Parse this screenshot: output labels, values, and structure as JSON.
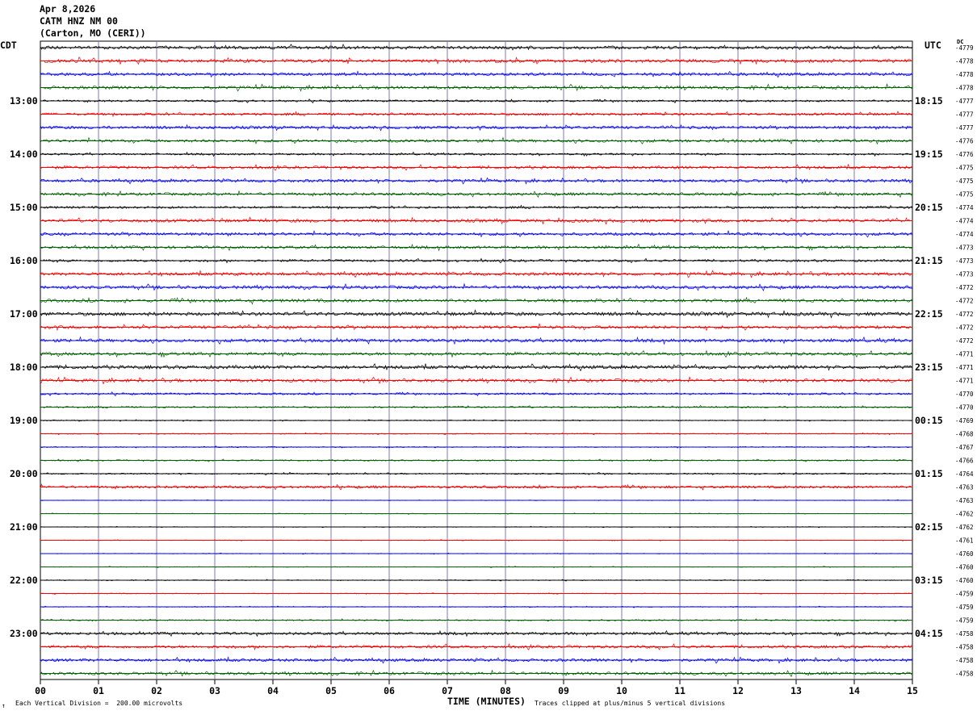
{
  "header": {
    "date": "Apr 8,2026",
    "station": "CATM HNZ NM 00",
    "location": "(Carton, MO (CERI))"
  },
  "labels": {
    "left_tz": "CDT",
    "right_tz": "UTC",
    "dc": "DC"
  },
  "footer": {
    "scale_note": "Each Vertical Division =  200.00 microvolts",
    "clip_note": "Traces clipped at plus/minus 5 vertical divisions",
    "corner_mark": "↑"
  },
  "colors": {
    "trace_cycle": [
      "#000000",
      "#ff0000",
      "#0000ff",
      "#006400"
    ],
    "grid": "#7b7bb0"
  },
  "chart_data": {
    "type": "line",
    "title": "Apr 8,2026 CATM HNZ NM 00 (Carton, MO (CERI))",
    "xlabel": "TIME (MINUTES)",
    "xlim": [
      0,
      15
    ],
    "x_ticks": [
      "00",
      "01",
      "02",
      "03",
      "04",
      "05",
      "06",
      "07",
      "08",
      "09",
      "10",
      "11",
      "12",
      "13",
      "14",
      "15"
    ],
    "trace_minutes": 15,
    "left_time_labels": [
      "13:00",
      "14:00",
      "15:00",
      "16:00",
      "17:00",
      "18:00",
      "19:00",
      "20:00",
      "21:00",
      "22:00",
      "23:00"
    ],
    "right_time_labels": [
      "18:15",
      "19:15",
      "20:15",
      "21:15",
      "22:15",
      "23:15",
      "00:15",
      "01:15",
      "02:15",
      "03:15",
      "04:15"
    ],
    "dc_offsets": [
      -4779,
      -4778,
      -4778,
      -4778,
      -4777,
      -4777,
      -4777,
      -4776,
      -4776,
      -4775,
      -4775,
      -4775,
      -4774,
      -4774,
      -4774,
      -4773,
      -4773,
      -4773,
      -4772,
      -4772,
      -4772,
      -4772,
      -4772,
      -4771,
      -4771,
      -4771,
      -4770,
      -4770,
      -4769,
      -4768,
      -4767,
      -4766,
      -4764,
      -4763,
      -4763,
      -4762,
      -4762,
      -4761,
      -4760,
      -4760,
      -4760,
      -4759,
      -4759,
      -4759,
      -4758,
      -4758,
      -4758,
      -4758
    ],
    "noise_level": [
      2.0,
      2.2,
      1.8,
      2.0,
      1.2,
      1.6,
      1.8,
      1.8,
      1.2,
      1.8,
      1.8,
      1.8,
      1.4,
      2.0,
      1.8,
      1.8,
      1.4,
      2.0,
      2.0,
      2.0,
      2.2,
      2.0,
      2.0,
      2.0,
      2.2,
      2.0,
      1.2,
      1.0,
      0.6,
      0.6,
      0.6,
      0.8,
      0.8,
      1.6,
      0.4,
      0.4,
      0.4,
      0.4,
      0.4,
      0.4,
      0.5,
      0.5,
      0.5,
      0.8,
      1.6,
      1.8,
      1.8,
      1.8
    ]
  }
}
